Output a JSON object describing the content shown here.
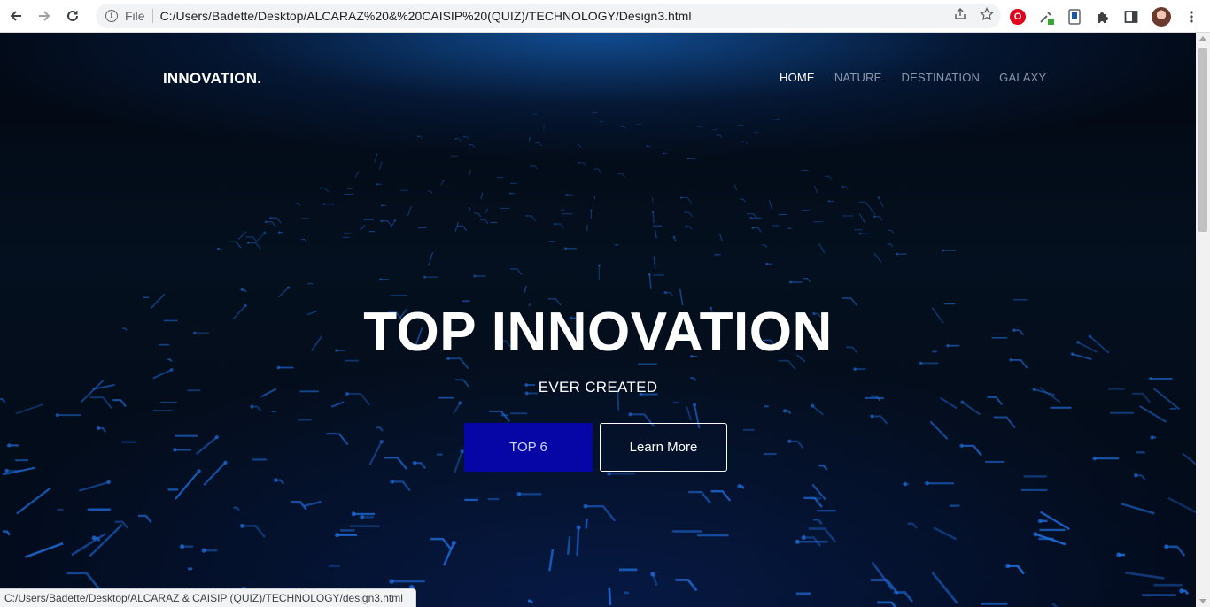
{
  "browser": {
    "back_icon": "arrow-left-icon",
    "forward_icon": "arrow-right-icon",
    "reload_icon": "reload-icon",
    "info_symbol": "i",
    "scheme_label": "File",
    "url": "C:/Users/Badette/Desktop/ALCARAZ%20&%20CAISIP%20(QUIZ)/TECHNOLOGY/Design3.html",
    "status_url": "C:/Users/Badette/Desktop/ALCARAZ & CAISIP (QUIZ)/TECHNOLOGY/design3.html"
  },
  "site": {
    "logo": "INNOVATION.",
    "nav": [
      {
        "label": "HOME",
        "active": true
      },
      {
        "label": "NATURE",
        "active": false
      },
      {
        "label": "DESTINATION",
        "active": false
      },
      {
        "label": "GALAXY",
        "active": false
      }
    ],
    "hero": {
      "title": "TOP INNOVATION",
      "subtitle": "EVER CREATED",
      "primary_button": "TOP 6",
      "secondary_button": "Learn More"
    }
  },
  "colors": {
    "primary_button_bg": "#0606a6",
    "nav_inactive": "#8a97ab",
    "nav_active": "#ffffff",
    "circuit_blue": "#1f6fe0"
  }
}
